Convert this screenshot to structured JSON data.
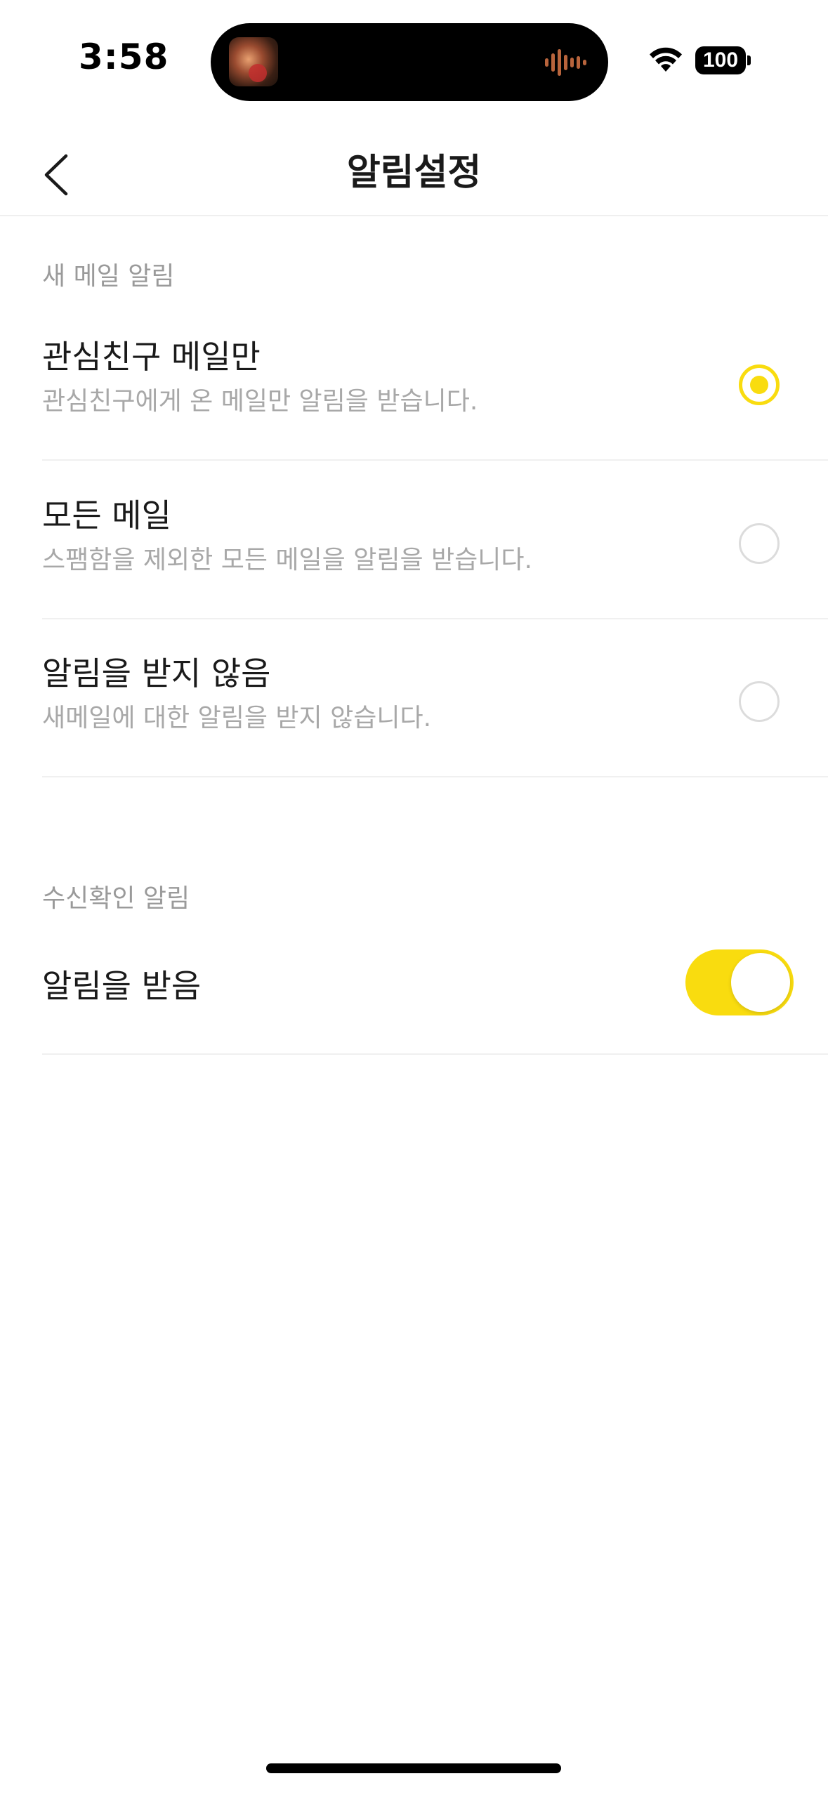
{
  "status_bar": {
    "time": "3:58",
    "battery": "100",
    "wifi_icon": "wifi-icon",
    "island_artwork_icon": "album-art-icon",
    "island_wave_icon": "audio-waveform-icon"
  },
  "header": {
    "title": "알림설정",
    "back_icon": "chevron-left-icon"
  },
  "new_mail_section": {
    "header": "새 메일 알림",
    "options": [
      {
        "title": "관심친구 메일만",
        "description": "관심친구에게 온 메일만 알림을 받습니다.",
        "selected": true
      },
      {
        "title": "모든 메일",
        "description": "스팸함을 제외한 모든 메일을 알림을 받습니다.",
        "selected": false
      },
      {
        "title": "알림을 받지 않음",
        "description": "새메일에 대한 알림을 받지 않습니다.",
        "selected": false
      }
    ]
  },
  "read_receipt_section": {
    "header": "수신확인 알림",
    "toggle_label": "알림을 받음",
    "toggle_on": true
  },
  "colors": {
    "accent": "#f9dc0f",
    "secondary_text": "#a8a8a8",
    "divider": "#f0f0f0"
  }
}
